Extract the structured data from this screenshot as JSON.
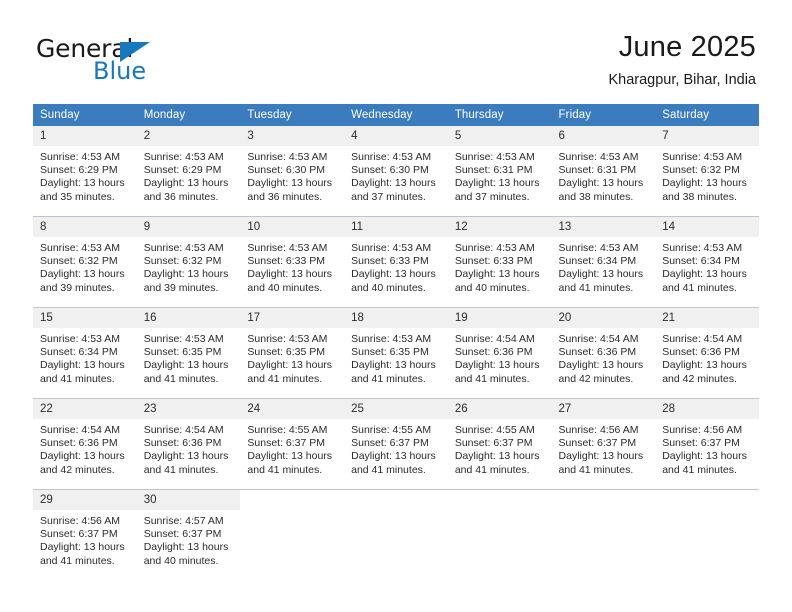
{
  "brand": {
    "name_top": "General",
    "name_bottom": "Blue",
    "triangle_icon": "brand-triangle-icon",
    "color_blue": "#1878be",
    "color_dark": "#1a1a1a"
  },
  "header": {
    "title": "June 2025",
    "subtitle": "Kharagpur, Bihar, India"
  },
  "theme": {
    "header_row_bg": "#3a7cbe",
    "header_row_text": "#ffffff",
    "daynum_band_bg": "#f0f0f0",
    "grid_line": "#b9c7d4",
    "body_text": "#2b2b2b"
  },
  "weekday_headers": [
    "Sunday",
    "Monday",
    "Tuesday",
    "Wednesday",
    "Thursday",
    "Friday",
    "Saturday"
  ],
  "labels": {
    "sunrise_prefix": "Sunrise:",
    "sunset_prefix": "Sunset:",
    "daylight_prefix": "Daylight:"
  },
  "weeks": [
    [
      {
        "day": "1",
        "sunrise": "Sunrise: 4:53 AM",
        "sunset": "Sunset: 6:29 PM",
        "daylight_line1": "Daylight: 13 hours",
        "daylight_line2": "and 35 minutes."
      },
      {
        "day": "2",
        "sunrise": "Sunrise: 4:53 AM",
        "sunset": "Sunset: 6:29 PM",
        "daylight_line1": "Daylight: 13 hours",
        "daylight_line2": "and 36 minutes."
      },
      {
        "day": "3",
        "sunrise": "Sunrise: 4:53 AM",
        "sunset": "Sunset: 6:30 PM",
        "daylight_line1": "Daylight: 13 hours",
        "daylight_line2": "and 36 minutes."
      },
      {
        "day": "4",
        "sunrise": "Sunrise: 4:53 AM",
        "sunset": "Sunset: 6:30 PM",
        "daylight_line1": "Daylight: 13 hours",
        "daylight_line2": "and 37 minutes."
      },
      {
        "day": "5",
        "sunrise": "Sunrise: 4:53 AM",
        "sunset": "Sunset: 6:31 PM",
        "daylight_line1": "Daylight: 13 hours",
        "daylight_line2": "and 37 minutes."
      },
      {
        "day": "6",
        "sunrise": "Sunrise: 4:53 AM",
        "sunset": "Sunset: 6:31 PM",
        "daylight_line1": "Daylight: 13 hours",
        "daylight_line2": "and 38 minutes."
      },
      {
        "day": "7",
        "sunrise": "Sunrise: 4:53 AM",
        "sunset": "Sunset: 6:32 PM",
        "daylight_line1": "Daylight: 13 hours",
        "daylight_line2": "and 38 minutes."
      }
    ],
    [
      {
        "day": "8",
        "sunrise": "Sunrise: 4:53 AM",
        "sunset": "Sunset: 6:32 PM",
        "daylight_line1": "Daylight: 13 hours",
        "daylight_line2": "and 39 minutes."
      },
      {
        "day": "9",
        "sunrise": "Sunrise: 4:53 AM",
        "sunset": "Sunset: 6:32 PM",
        "daylight_line1": "Daylight: 13 hours",
        "daylight_line2": "and 39 minutes."
      },
      {
        "day": "10",
        "sunrise": "Sunrise: 4:53 AM",
        "sunset": "Sunset: 6:33 PM",
        "daylight_line1": "Daylight: 13 hours",
        "daylight_line2": "and 40 minutes."
      },
      {
        "day": "11",
        "sunrise": "Sunrise: 4:53 AM",
        "sunset": "Sunset: 6:33 PM",
        "daylight_line1": "Daylight: 13 hours",
        "daylight_line2": "and 40 minutes."
      },
      {
        "day": "12",
        "sunrise": "Sunrise: 4:53 AM",
        "sunset": "Sunset: 6:33 PM",
        "daylight_line1": "Daylight: 13 hours",
        "daylight_line2": "and 40 minutes."
      },
      {
        "day": "13",
        "sunrise": "Sunrise: 4:53 AM",
        "sunset": "Sunset: 6:34 PM",
        "daylight_line1": "Daylight: 13 hours",
        "daylight_line2": "and 41 minutes."
      },
      {
        "day": "14",
        "sunrise": "Sunrise: 4:53 AM",
        "sunset": "Sunset: 6:34 PM",
        "daylight_line1": "Daylight: 13 hours",
        "daylight_line2": "and 41 minutes."
      }
    ],
    [
      {
        "day": "15",
        "sunrise": "Sunrise: 4:53 AM",
        "sunset": "Sunset: 6:34 PM",
        "daylight_line1": "Daylight: 13 hours",
        "daylight_line2": "and 41 minutes."
      },
      {
        "day": "16",
        "sunrise": "Sunrise: 4:53 AM",
        "sunset": "Sunset: 6:35 PM",
        "daylight_line1": "Daylight: 13 hours",
        "daylight_line2": "and 41 minutes."
      },
      {
        "day": "17",
        "sunrise": "Sunrise: 4:53 AM",
        "sunset": "Sunset: 6:35 PM",
        "daylight_line1": "Daylight: 13 hours",
        "daylight_line2": "and 41 minutes."
      },
      {
        "day": "18",
        "sunrise": "Sunrise: 4:53 AM",
        "sunset": "Sunset: 6:35 PM",
        "daylight_line1": "Daylight: 13 hours",
        "daylight_line2": "and 41 minutes."
      },
      {
        "day": "19",
        "sunrise": "Sunrise: 4:54 AM",
        "sunset": "Sunset: 6:36 PM",
        "daylight_line1": "Daylight: 13 hours",
        "daylight_line2": "and 41 minutes."
      },
      {
        "day": "20",
        "sunrise": "Sunrise: 4:54 AM",
        "sunset": "Sunset: 6:36 PM",
        "daylight_line1": "Daylight: 13 hours",
        "daylight_line2": "and 42 minutes."
      },
      {
        "day": "21",
        "sunrise": "Sunrise: 4:54 AM",
        "sunset": "Sunset: 6:36 PM",
        "daylight_line1": "Daylight: 13 hours",
        "daylight_line2": "and 42 minutes."
      }
    ],
    [
      {
        "day": "22",
        "sunrise": "Sunrise: 4:54 AM",
        "sunset": "Sunset: 6:36 PM",
        "daylight_line1": "Daylight: 13 hours",
        "daylight_line2": "and 42 minutes."
      },
      {
        "day": "23",
        "sunrise": "Sunrise: 4:54 AM",
        "sunset": "Sunset: 6:36 PM",
        "daylight_line1": "Daylight: 13 hours",
        "daylight_line2": "and 41 minutes."
      },
      {
        "day": "24",
        "sunrise": "Sunrise: 4:55 AM",
        "sunset": "Sunset: 6:37 PM",
        "daylight_line1": "Daylight: 13 hours",
        "daylight_line2": "and 41 minutes."
      },
      {
        "day": "25",
        "sunrise": "Sunrise: 4:55 AM",
        "sunset": "Sunset: 6:37 PM",
        "daylight_line1": "Daylight: 13 hours",
        "daylight_line2": "and 41 minutes."
      },
      {
        "day": "26",
        "sunrise": "Sunrise: 4:55 AM",
        "sunset": "Sunset: 6:37 PM",
        "daylight_line1": "Daylight: 13 hours",
        "daylight_line2": "and 41 minutes."
      },
      {
        "day": "27",
        "sunrise": "Sunrise: 4:56 AM",
        "sunset": "Sunset: 6:37 PM",
        "daylight_line1": "Daylight: 13 hours",
        "daylight_line2": "and 41 minutes."
      },
      {
        "day": "28",
        "sunrise": "Sunrise: 4:56 AM",
        "sunset": "Sunset: 6:37 PM",
        "daylight_line1": "Daylight: 13 hours",
        "daylight_line2": "and 41 minutes."
      }
    ],
    [
      {
        "day": "29",
        "sunrise": "Sunrise: 4:56 AM",
        "sunset": "Sunset: 6:37 PM",
        "daylight_line1": "Daylight: 13 hours",
        "daylight_line2": "and 41 minutes."
      },
      {
        "day": "30",
        "sunrise": "Sunrise: 4:57 AM",
        "sunset": "Sunset: 6:37 PM",
        "daylight_line1": "Daylight: 13 hours",
        "daylight_line2": "and 40 minutes."
      },
      {
        "day": "",
        "sunrise": "",
        "sunset": "",
        "daylight_line1": "",
        "daylight_line2": ""
      },
      {
        "day": "",
        "sunrise": "",
        "sunset": "",
        "daylight_line1": "",
        "daylight_line2": ""
      },
      {
        "day": "",
        "sunrise": "",
        "sunset": "",
        "daylight_line1": "",
        "daylight_line2": ""
      },
      {
        "day": "",
        "sunrise": "",
        "sunset": "",
        "daylight_line1": "",
        "daylight_line2": ""
      },
      {
        "day": "",
        "sunrise": "",
        "sunset": "",
        "daylight_line1": "",
        "daylight_line2": ""
      }
    ]
  ]
}
